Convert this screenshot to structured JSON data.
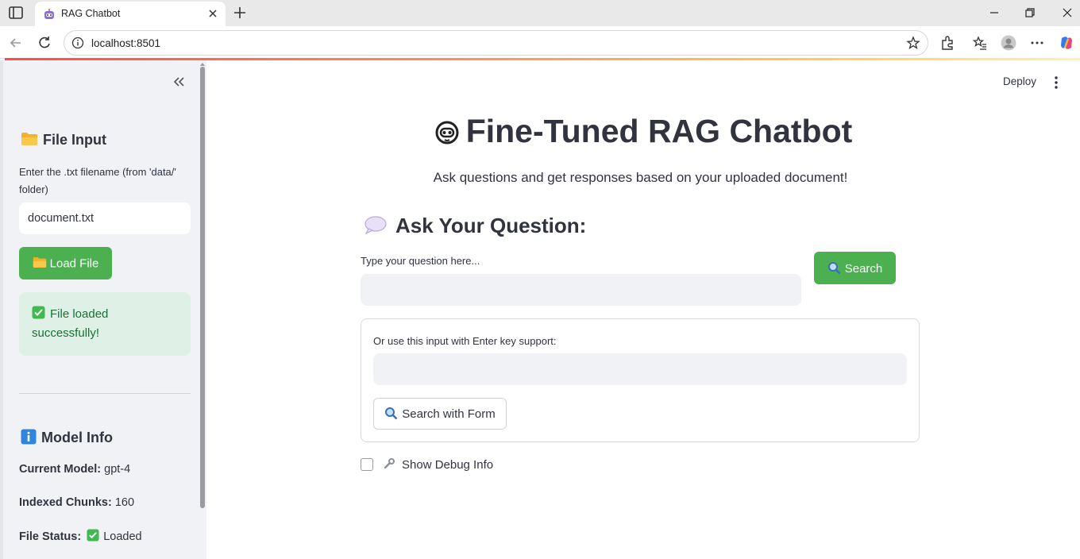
{
  "browser": {
    "tab_title": "RAG Chatbot",
    "url": "localhost:8501"
  },
  "sidebar": {
    "file_input_heading": "File Input",
    "file_input_label": "Enter the .txt filename (from 'data/' folder)",
    "file_input_value": "document.txt",
    "load_button": "Load File",
    "success_message": "File loaded successfully!",
    "model_info_heading": "Model Info",
    "current_model_label": "Current Model:",
    "current_model_value": "gpt-4",
    "indexed_chunks_label": "Indexed Chunks:",
    "indexed_chunks_value": "160",
    "file_status_label": "File Status:",
    "file_status_value": "Loaded"
  },
  "main": {
    "deploy": "Deploy",
    "title": "Fine-Tuned RAG Chatbot",
    "subtitle": "Ask questions and get responses based on your uploaded document!",
    "section_heading": "Ask Your Question:",
    "question_label": "Type your question here...",
    "question_value": "",
    "search_button": "Search",
    "form_label": "Or use this input with Enter key support:",
    "form_value": "",
    "form_button": "Search with Form",
    "debug_label": "Show Debug Info",
    "debug_checked": false
  },
  "colors": {
    "accent_green": "#4caf50",
    "success_bg": "#dff0e7",
    "success_text": "#177233",
    "sidebar_bg": "#f0f2f6"
  }
}
